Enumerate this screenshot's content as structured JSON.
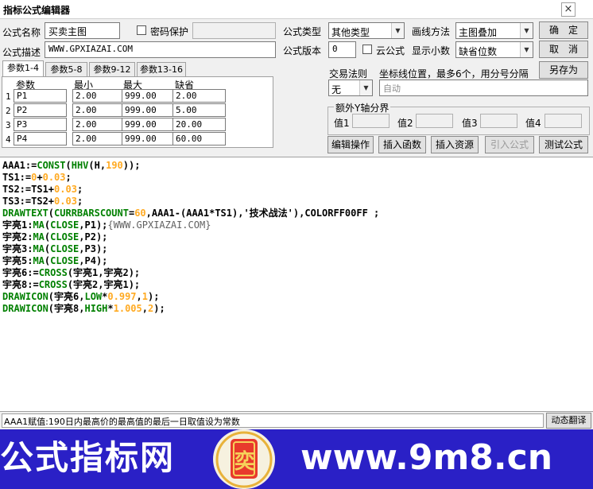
{
  "window": {
    "title": "指标公式编辑器",
    "close_glyph": "×"
  },
  "form": {
    "name_label": "公式名称",
    "name_value": "买卖主图",
    "password_label": "密码保护",
    "desc_label": "公式描述",
    "desc_value": "WWW.GPXIAZAI.COM",
    "type_label": "公式类型",
    "type_value": "其他类型",
    "draw_label": "画线方法",
    "draw_value": "主图叠加",
    "version_label": "公式版本",
    "version_value": "0",
    "cloud_label": "云公式",
    "decimals_label": "显示小数",
    "decimals_value": "缺省位数"
  },
  "buttons": {
    "ok": "确　定",
    "cancel": "取　消",
    "save_as": "另存为",
    "edit_ops": "编辑操作",
    "insert_func": "插入函数",
    "insert_res": "插入资源",
    "import_formula": "引入公式",
    "test_formula": "测试公式",
    "dynamic_translate": "动态翻译"
  },
  "tabs": [
    "参数1-4",
    "参数5-8",
    "参数9-12",
    "参数13-16"
  ],
  "params": {
    "headers": [
      "参数",
      "最小",
      "最大",
      "缺省"
    ],
    "rows": [
      {
        "idx": "1",
        "name": "P1",
        "min": "2.00",
        "max": "999.00",
        "def": "2.00"
      },
      {
        "idx": "2",
        "name": "P2",
        "min": "2.00",
        "max": "999.00",
        "def": "5.00"
      },
      {
        "idx": "3",
        "name": "P3",
        "min": "2.00",
        "max": "999.00",
        "def": "20.00"
      },
      {
        "idx": "4",
        "name": "P4",
        "min": "2.00",
        "max": "999.00",
        "def": "60.00"
      }
    ]
  },
  "trade": {
    "rule_label": "交易法则",
    "rule_value": "无",
    "coord_label": "坐标线位置，最多6个，用分号分隔",
    "coord_placeholder": "自动",
    "yaxis_label": "额外Y轴分界",
    "val_labels": [
      "值1",
      "值2",
      "值3",
      "值4"
    ]
  },
  "code_lines": [
    [
      {
        "t": "AAA1:=",
        "c": ""
      },
      {
        "t": "CONST",
        "c": "k"
      },
      {
        "t": "(",
        "c": ""
      },
      {
        "t": "HHV",
        "c": "k"
      },
      {
        "t": "(H,",
        "c": ""
      },
      {
        "t": "190",
        "c": "n"
      },
      {
        "t": "));",
        "c": ""
      }
    ],
    [
      {
        "t": "TS1:=",
        "c": ""
      },
      {
        "t": "0",
        "c": "n"
      },
      {
        "t": "+",
        "c": ""
      },
      {
        "t": "0.03",
        "c": "n"
      },
      {
        "t": ";",
        "c": ""
      }
    ],
    [
      {
        "t": "TS2:=TS1+",
        "c": ""
      },
      {
        "t": "0.03",
        "c": "n"
      },
      {
        "t": ";",
        "c": ""
      }
    ],
    [
      {
        "t": "TS3:=TS2+",
        "c": ""
      },
      {
        "t": "0.03",
        "c": "n"
      },
      {
        "t": ";",
        "c": ""
      }
    ],
    [
      {
        "t": "DRAWTEXT",
        "c": "k"
      },
      {
        "t": "(",
        "c": ""
      },
      {
        "t": "CURRBARSCOUNT",
        "c": "k"
      },
      {
        "t": "=",
        "c": ""
      },
      {
        "t": "60",
        "c": "n"
      },
      {
        "t": ",AAA1-(AAA1*TS1),'技术战法'),COLORFF00FF ;",
        "c": ""
      }
    ],
    [
      {
        "t": "宇亮1:",
        "c": ""
      },
      {
        "t": "MA",
        "c": "k"
      },
      {
        "t": "(",
        "c": ""
      },
      {
        "t": "CLOSE",
        "c": "k"
      },
      {
        "t": ",P1);",
        "c": ""
      },
      {
        "t": "{WWW.GPXIAZAI.COM}",
        "c": "c"
      }
    ],
    [
      {
        "t": "宇亮2:",
        "c": ""
      },
      {
        "t": "MA",
        "c": "k"
      },
      {
        "t": "(",
        "c": ""
      },
      {
        "t": "CLOSE",
        "c": "k"
      },
      {
        "t": ",P2);",
        "c": ""
      }
    ],
    [
      {
        "t": "宇亮3:",
        "c": ""
      },
      {
        "t": "MA",
        "c": "k"
      },
      {
        "t": "(",
        "c": ""
      },
      {
        "t": "CLOSE",
        "c": "k"
      },
      {
        "t": ",P3);",
        "c": ""
      }
    ],
    [
      {
        "t": "宇亮5:",
        "c": ""
      },
      {
        "t": "MA",
        "c": "k"
      },
      {
        "t": "(",
        "c": ""
      },
      {
        "t": "CLOSE",
        "c": "k"
      },
      {
        "t": ",P4);",
        "c": ""
      }
    ],
    [
      {
        "t": "宇亮6:=",
        "c": ""
      },
      {
        "t": "CROSS",
        "c": "k"
      },
      {
        "t": "(宇亮1,宇亮2);",
        "c": ""
      }
    ],
    [
      {
        "t": "宇亮8:=",
        "c": ""
      },
      {
        "t": "CROSS",
        "c": "k"
      },
      {
        "t": "(宇亮2,宇亮1);",
        "c": ""
      }
    ],
    [
      {
        "t": "DRAWICON",
        "c": "k"
      },
      {
        "t": "(宇亮6,",
        "c": ""
      },
      {
        "t": "LOW",
        "c": "k"
      },
      {
        "t": "*",
        "c": ""
      },
      {
        "t": "0.997",
        "c": "n"
      },
      {
        "t": ",",
        "c": ""
      },
      {
        "t": "1",
        "c": "n"
      },
      {
        "t": ");",
        "c": ""
      }
    ],
    [
      {
        "t": "DRAWICON",
        "c": "k"
      },
      {
        "t": "(宇亮8,",
        "c": ""
      },
      {
        "t": "HIGH",
        "c": "k"
      },
      {
        "t": "*",
        "c": ""
      },
      {
        "t": "1.005",
        "c": "n"
      },
      {
        "t": ",",
        "c": ""
      },
      {
        "t": "2",
        "c": "n"
      },
      {
        "t": ");",
        "c": ""
      }
    ]
  ],
  "status": {
    "text": "AAA1赋值:190日内最高价的最高值的最后一日取值设为常数"
  },
  "banner": {
    "left_text": "公式指标网",
    "right_text": "www.9m8.cn",
    "seal_text": "奕"
  },
  "colors": {
    "keyword": "#008000",
    "number": "#ffaa22",
    "banner_bg": "#2a20c6"
  }
}
